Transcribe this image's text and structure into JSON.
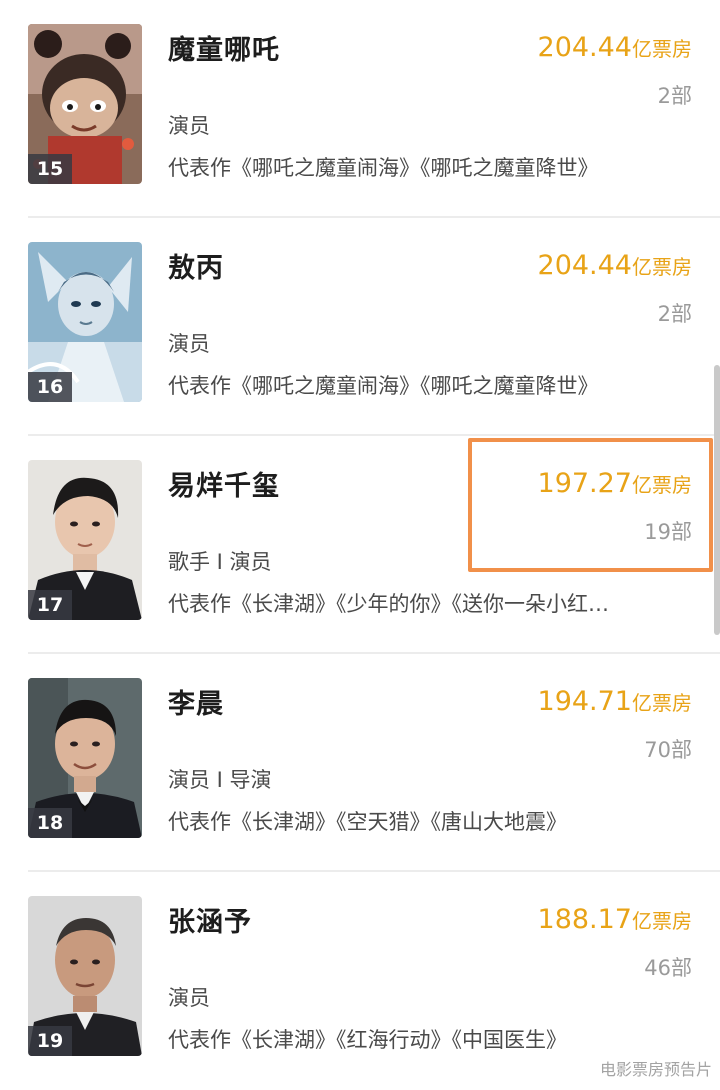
{
  "items": [
    {
      "rank": "15",
      "name": "魔童哪吒",
      "box_value": "204.44",
      "box_unit": "亿票房",
      "film_count": "2部",
      "roles": "演员",
      "works": "代表作《哪吒之魔童闹海》《哪吒之魔童降世》",
      "poster": "animated-character-nezha-poster"
    },
    {
      "rank": "16",
      "name": "敖丙",
      "box_value": "204.44",
      "box_unit": "亿票房",
      "film_count": "2部",
      "roles": "演员",
      "works": "代表作《哪吒之魔童闹海》《哪吒之魔童降世》",
      "poster": "animated-character-aobing-poster"
    },
    {
      "rank": "17",
      "name": "易烊千玺",
      "box_value": "197.27",
      "box_unit": "亿票房",
      "film_count": "19部",
      "roles": "歌手 I 演员",
      "works": "代表作《长津湖》《少年的你》《送你一朵小红…",
      "poster": "actor-portrait"
    },
    {
      "rank": "18",
      "name": "李晨",
      "box_value": "194.71",
      "box_unit": "亿票房",
      "film_count": "70部",
      "roles": "演员 I 导演",
      "works": "代表作《长津湖》《空天猎》《唐山大地震》",
      "poster": "actor-portrait"
    },
    {
      "rank": "19",
      "name": "张涵予",
      "box_value": "188.17",
      "box_unit": "亿票房",
      "film_count": "46部",
      "roles": "演员",
      "works": "代表作《长津湖》《红海行动》《中国医生》",
      "poster": "actor-portrait"
    }
  ],
  "watermark": "电影票房预告片",
  "colors": {
    "box_office": "#e8a317",
    "highlight_border": "#f1904a",
    "rank_badge": "#373a42"
  }
}
